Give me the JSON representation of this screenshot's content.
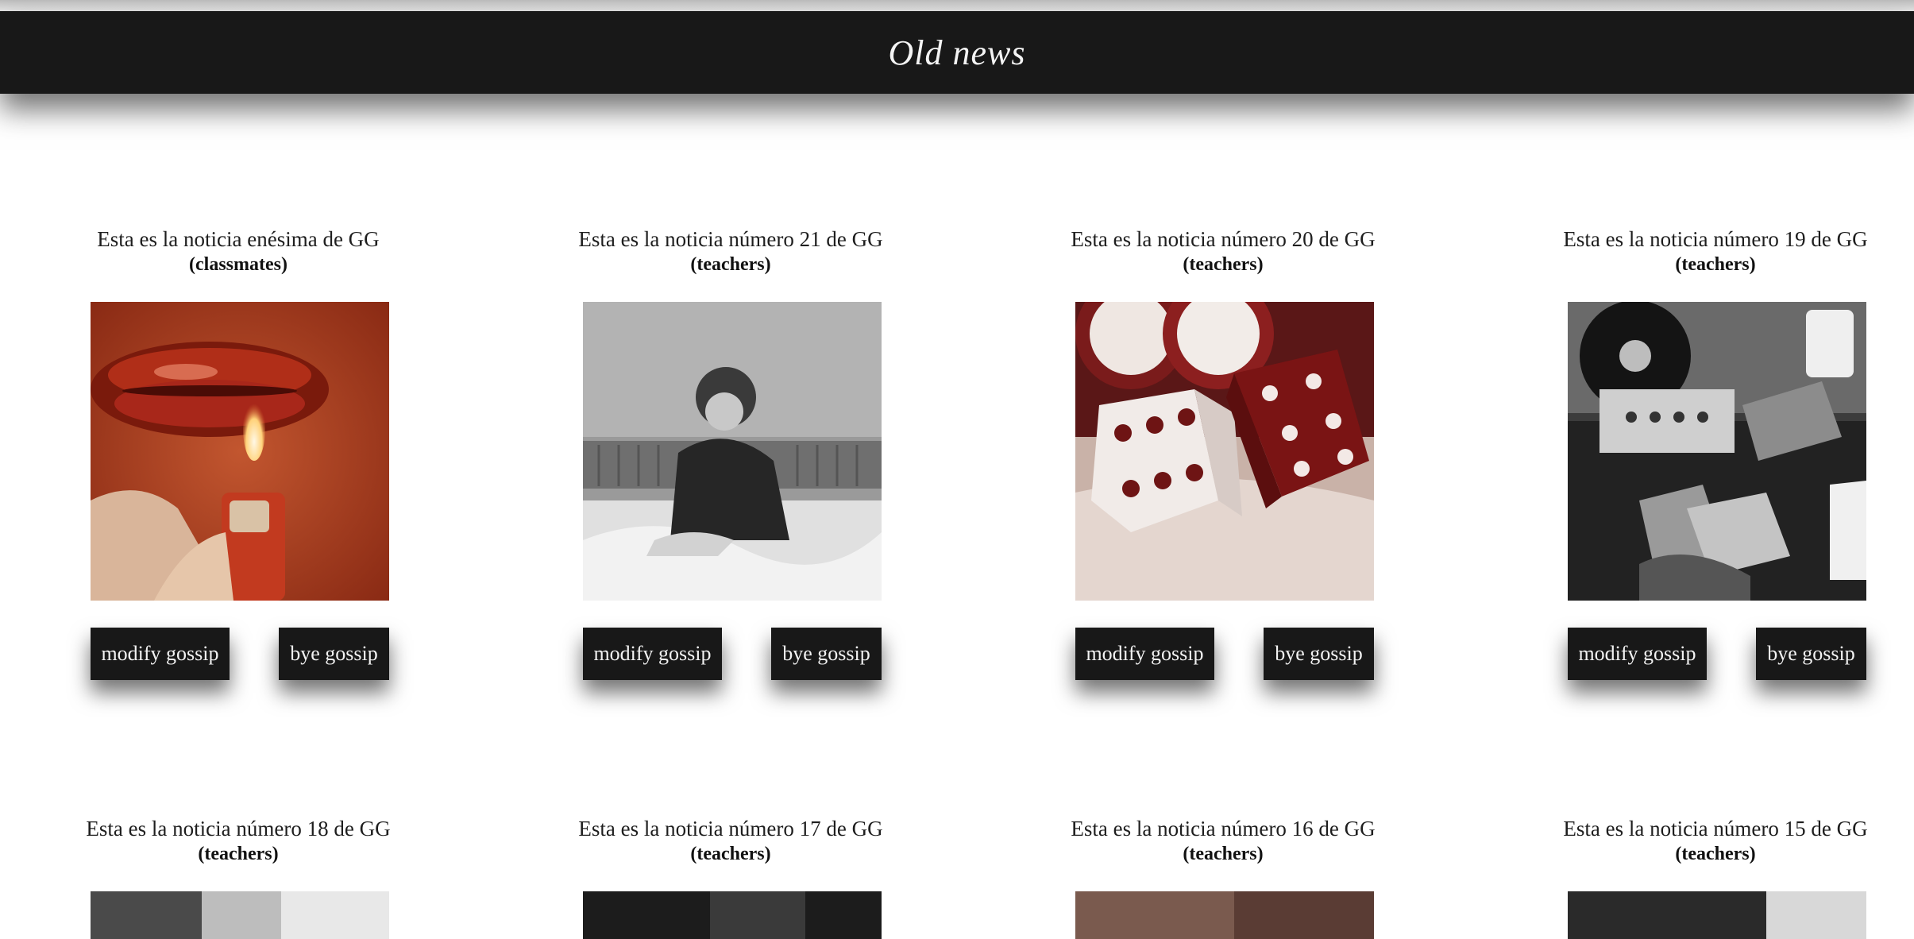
{
  "header": {
    "title": "Old news"
  },
  "buttons": {
    "modify": "modify gossip",
    "delete": "bye gossip"
  },
  "news_row1": [
    {
      "title": "Esta es la noticia enésima de GG",
      "category": "(classmates)",
      "image": "lips-lighter-photo"
    },
    {
      "title": "Esta es la noticia número 21 de GG",
      "category": "(teachers)",
      "image": "woman-phone-bed-photo"
    },
    {
      "title": "Esta es la noticia número 20 de GG",
      "category": "(teachers)",
      "image": "dice-poker-chips-photo"
    },
    {
      "title": "Esta es la noticia número 19 de GG",
      "category": "(teachers)",
      "image": "record-player-photo"
    }
  ],
  "news_row2": [
    {
      "title": "Esta es la noticia número 18 de GG",
      "category": "(teachers)"
    },
    {
      "title": "Esta es la noticia número 17 de GG",
      "category": "(teachers)"
    },
    {
      "title": "Esta es la noticia número 16 de GG",
      "category": "(teachers)"
    },
    {
      "title": "Esta es la noticia número 15 de GG",
      "category": "(teachers)"
    }
  ],
  "colors": {
    "header_bg": "#181818",
    "button_bg": "#181818",
    "button_text": "#f3f3f3",
    "page_bg": "#ffffff"
  }
}
